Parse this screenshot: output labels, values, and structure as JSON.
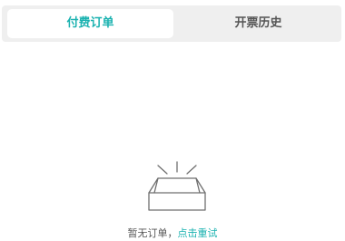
{
  "tabs": {
    "active_label": "付费订单",
    "inactive_label": "开票历史"
  },
  "empty_state": {
    "icon": "empty-box-icon",
    "message": "暂无订单，",
    "retry_label": "点击重试"
  },
  "colors": {
    "accent": "#1ab2b0",
    "tab_bg": "#efefef",
    "text_muted": "#555555",
    "icon_stroke": "#6f6f6f"
  }
}
